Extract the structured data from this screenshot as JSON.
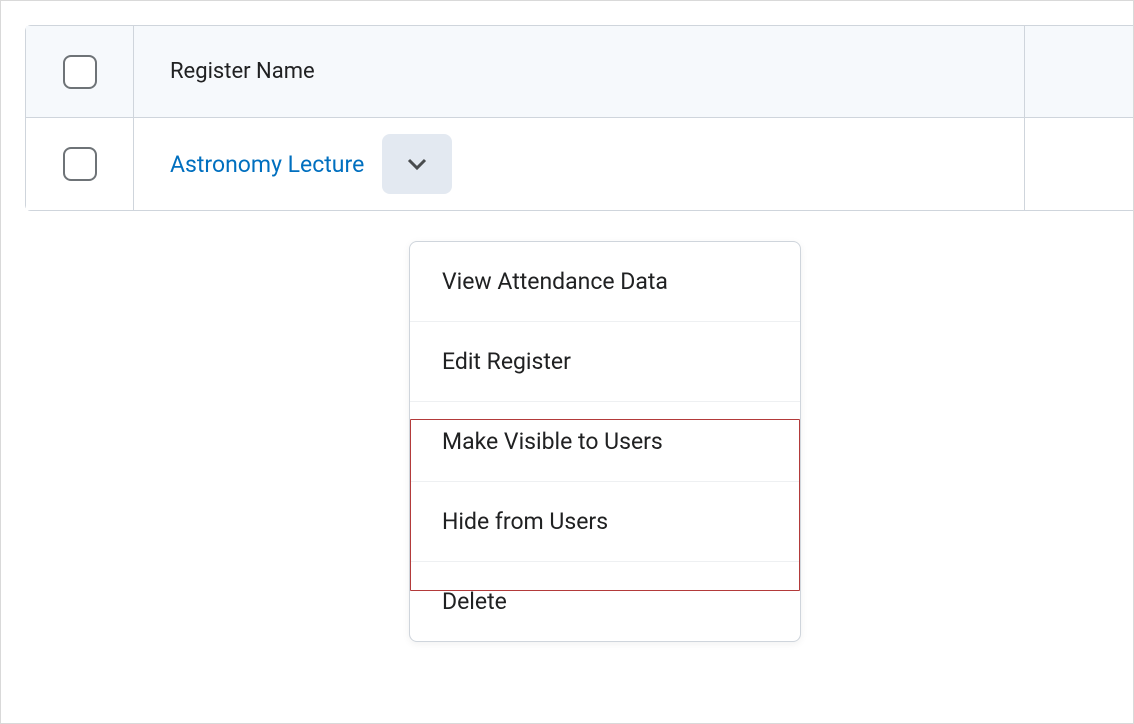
{
  "table": {
    "header": {
      "name_label": "Register Name"
    },
    "rows": [
      {
        "name": "Astronomy Lecture"
      }
    ]
  },
  "dropdown": {
    "items": [
      {
        "label": "View Attendance Data"
      },
      {
        "label": "Edit Register"
      },
      {
        "label": "Make Visible to Users"
      },
      {
        "label": "Hide from Users"
      },
      {
        "label": "Delete"
      }
    ]
  }
}
